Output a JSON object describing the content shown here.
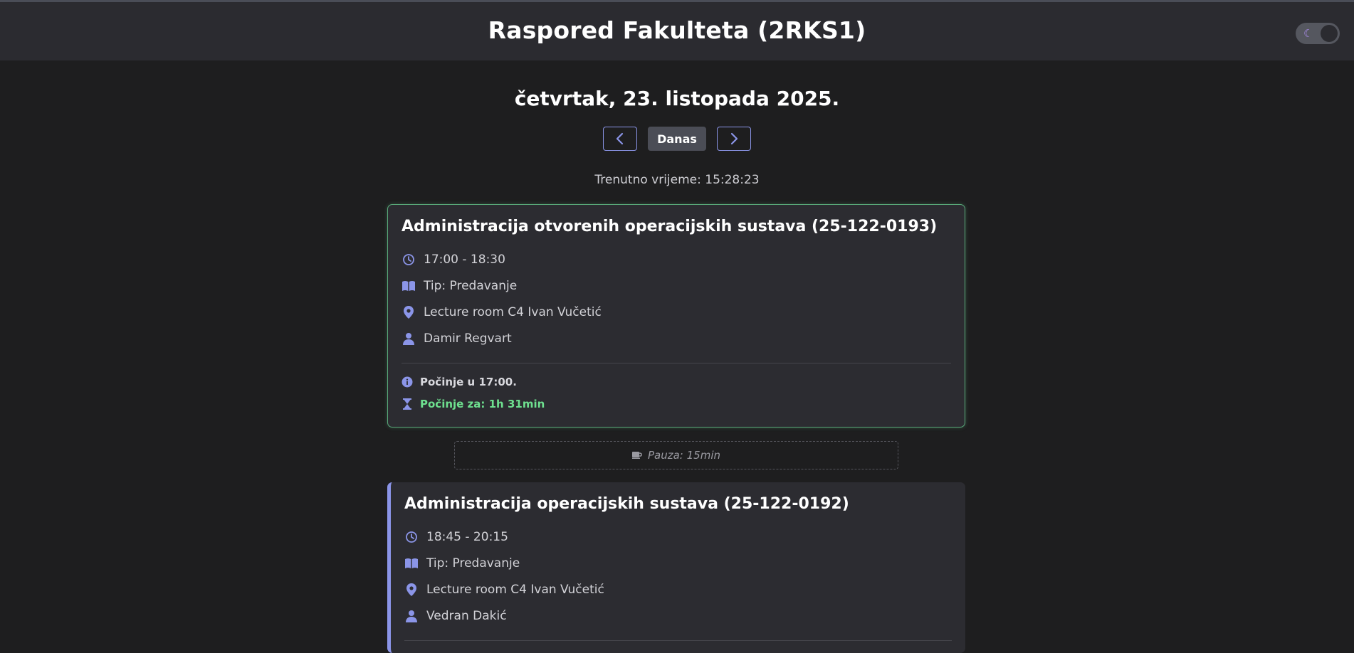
{
  "app": {
    "title": "Raspored Fakulteta (2RKS1)",
    "theme_toggle_icon": "moon-icon"
  },
  "date_heading": "četvrtak, 23. listopada 2025.",
  "nav": {
    "prev_icon": "chevron-left-icon",
    "today_label": "Danas",
    "next_icon": "chevron-right-icon"
  },
  "current_time": "Trenutno vrijeme: 15:28:23",
  "colors": {
    "accent": "#8b95e8",
    "active_border": "#58a879",
    "countdown": "#6ee08f"
  },
  "lectures": [
    {
      "title": "Administracija otvorenih operacijskih sustava (25-122-0193)",
      "time": "17:00 - 18:30",
      "type": "Tip: Predavanje",
      "room": "Lecture room C4 Ivan Vučetić",
      "lecturer": "Damir Regvart",
      "status": "Počinje u 17:00.",
      "countdown": "Počinje za: 1h 31min"
    },
    {
      "title": "Administracija operacijskih sustava (25-122-0192)",
      "time": "18:45 - 20:15",
      "type": "Tip: Predavanje",
      "room": "Lecture room C4 Ivan Vučetić",
      "lecturer": "Vedran Dakić"
    }
  ],
  "pause": {
    "icon": "coffee-icon",
    "label": "Pauza: 15min"
  }
}
